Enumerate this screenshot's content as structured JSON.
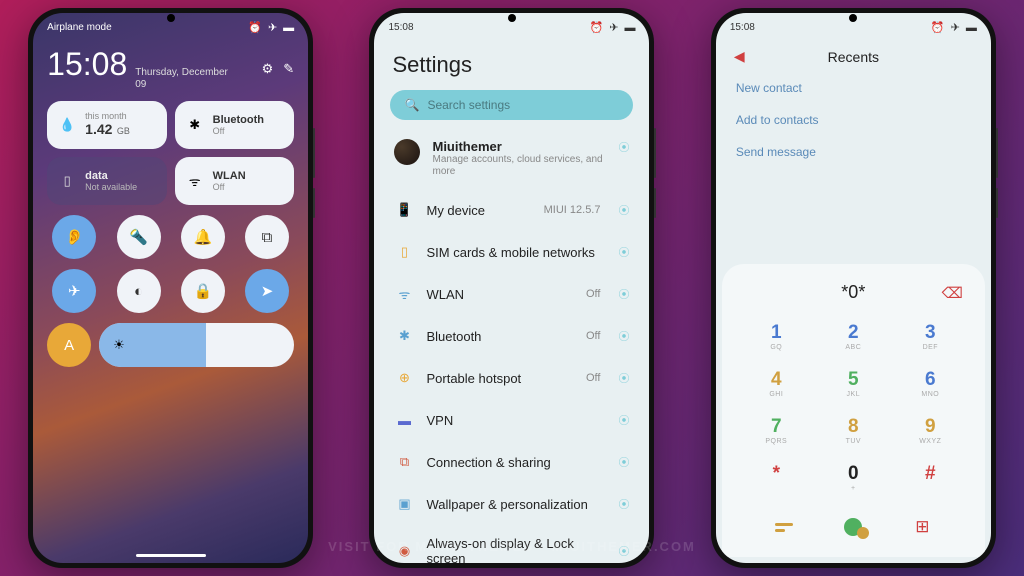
{
  "status": {
    "time": "15:08",
    "airplane": "Airplane mode"
  },
  "p1": {
    "time": "15:08",
    "date_top": "Thursday, December",
    "date_bot": "09",
    "tiles": {
      "data": {
        "period": "this month",
        "value": "1.42",
        "unit": "GB"
      },
      "bt": {
        "label": "Bluetooth",
        "sub": "Off"
      },
      "mdata": {
        "label": "data",
        "sub": "Not available"
      },
      "wlan": {
        "label": "WLAN",
        "sub": "Off"
      }
    }
  },
  "p2": {
    "title": "Settings",
    "search": "Search settings",
    "account": {
      "name": "Miuithemer",
      "sub": "Manage accounts, cloud services, and more"
    },
    "items": [
      {
        "ic": "📱",
        "c": "#5aa0d0",
        "label": "My device",
        "val": "MIUI 12.5.7"
      },
      {
        "ic": "▯",
        "c": "#e8a838",
        "label": "SIM cards & mobile networks",
        "val": ""
      },
      {
        "ic": "ᯤ",
        "c": "#5aa0d0",
        "label": "WLAN",
        "val": "Off"
      },
      {
        "ic": "✱",
        "c": "#5aa0d0",
        "label": "Bluetooth",
        "val": "Off"
      },
      {
        "ic": "⊕",
        "c": "#e8a838",
        "label": "Portable hotspot",
        "val": "Off"
      },
      {
        "ic": "▬",
        "c": "#5a6ad0",
        "label": "VPN",
        "val": ""
      },
      {
        "ic": "⧉",
        "c": "#d05a40",
        "label": "Connection & sharing",
        "val": ""
      },
      {
        "ic": "▣",
        "c": "#5aa0d0",
        "label": "Wallpaper & personalization",
        "val": ""
      },
      {
        "ic": "◉",
        "c": "#d05a40",
        "label": "Always-on display & Lock screen",
        "val": ""
      }
    ]
  },
  "p3": {
    "title": "Recents",
    "links": [
      "New contact",
      "Add to contacts",
      "Send message"
    ],
    "display": "*0*",
    "keys": [
      {
        "n": "1",
        "s": "GQ"
      },
      {
        "n": "2",
        "s": "ABC"
      },
      {
        "n": "3",
        "s": "DEF"
      },
      {
        "n": "4",
        "s": "GHI"
      },
      {
        "n": "5",
        "s": "JKL"
      },
      {
        "n": "6",
        "s": "MNO"
      },
      {
        "n": "7",
        "s": "PQRS"
      },
      {
        "n": "8",
        "s": "TUV"
      },
      {
        "n": "9",
        "s": "WXYZ"
      },
      {
        "n": "*",
        "s": ""
      },
      {
        "n": "0",
        "s": "+"
      },
      {
        "n": "#",
        "s": ""
      }
    ]
  },
  "watermark": "Visit for more themes - miuithemer.com"
}
